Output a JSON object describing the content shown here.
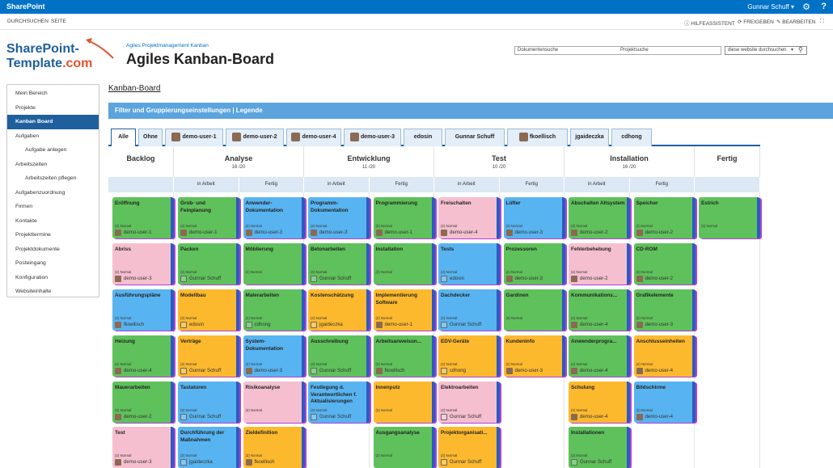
{
  "suitebar": {
    "brand": "SharePoint",
    "user": "Gunnar Schuff ▾",
    "gear": "⚙",
    "help": "?"
  },
  "ribbon": {
    "tabs": [
      "DURCHSUCHEN",
      "SEITE"
    ],
    "actions": [
      "ⓘ HILFEASSISTENT",
      "⟳ FREIGEBEN",
      "✎ BEARBEITEN",
      "⛶"
    ]
  },
  "logo": {
    "line1": "SharePoint-",
    "line2a": "Template",
    "line2b": ".com"
  },
  "site": {
    "subtitle": "Agiles Projektmanagement Kanban",
    "title": "Agiles Kanban-Board"
  },
  "search": {
    "scope1": "Dokumentensuche",
    "scope2": "Projektsuche",
    "placeholder": "diese website durchsuchen",
    "dropdown": "▾",
    "icon": "⚲"
  },
  "nav": [
    {
      "label": "Mein Bereich",
      "sub": false,
      "active": false
    },
    {
      "label": "Projekte",
      "sub": false,
      "active": false
    },
    {
      "label": "Kanban Board",
      "sub": false,
      "active": true
    },
    {
      "label": "Aufgaben",
      "sub": false,
      "active": false
    },
    {
      "label": "Aufgabe anlegen",
      "sub": true,
      "active": false
    },
    {
      "label": "Arbeitszeiten",
      "sub": false,
      "active": false
    },
    {
      "label": "Arbeitszeiten pflegen",
      "sub": true,
      "active": false
    },
    {
      "label": "Aufgabenzuordnung",
      "sub": false,
      "active": false
    },
    {
      "label": "Firmen",
      "sub": false,
      "active": false
    },
    {
      "label": "Kontakte",
      "sub": false,
      "active": false
    },
    {
      "label": "Projekttermine",
      "sub": false,
      "active": false
    },
    {
      "label": "Projektdokumente",
      "sub": false,
      "active": false
    },
    {
      "label": "Posteingang",
      "sub": false,
      "active": false
    },
    {
      "label": "Konfiguration",
      "sub": false,
      "active": false
    },
    {
      "label": "Websiteinhalte",
      "sub": false,
      "active": false
    }
  ],
  "breadcrumb": "Kanban-Board",
  "filterbar": "Filter und Gruppierungseinstellungen | Legende",
  "tabs": [
    {
      "label": "Alle",
      "avatar": false,
      "active": true
    },
    {
      "label": "Ohne",
      "avatar": false,
      "active": false
    },
    {
      "label": "demo-user-1",
      "avatar": true,
      "active": false
    },
    {
      "label": "demo-user-2",
      "avatar": true,
      "active": false
    },
    {
      "label": "demo-user-4",
      "avatar": true,
      "active": false
    },
    {
      "label": "demo-user-3",
      "avatar": true,
      "active": false
    },
    {
      "label": "edosin",
      "avatar": false,
      "active": false
    },
    {
      "label": "Gunnar Schuff",
      "avatar": false,
      "active": false
    },
    {
      "label": "fkoellisch",
      "avatar": true,
      "active": false
    },
    {
      "label": "jgaideczka",
      "avatar": false,
      "active": false
    },
    {
      "label": "cdhong",
      "avatar": false,
      "active": false
    }
  ],
  "columns": [
    {
      "name": "Backlog",
      "limit": "",
      "subs": []
    },
    {
      "name": "Analyse",
      "limit": "16 /20",
      "subs": [
        "in Arbeit",
        "Fertig"
      ]
    },
    {
      "name": "Entwicklung",
      "limit": "11 /20",
      "subs": [
        "in Arbeit",
        "Fertig"
      ]
    },
    {
      "name": "Test",
      "limit": "10 /20",
      "subs": [
        "in Arbeit",
        "Fertig"
      ]
    },
    {
      "name": "Installation",
      "limit": "16 /20",
      "subs": [
        "in Arbeit",
        "Fertig"
      ]
    },
    {
      "name": "Fertig",
      "limit": "",
      "subs": []
    }
  ],
  "priority_label": "(2) Normal",
  "lanes": [
    [
      {
        "title": "Eröffnung",
        "color": "green",
        "user": "demo-user-1",
        "photo": true
      },
      {
        "title": "Abriss",
        "color": "pink",
        "user": "demo-user-3",
        "photo": true
      },
      {
        "title": "Ausführungspläne",
        "color": "blue",
        "user": "fkoellisch",
        "photo": true
      },
      {
        "title": "Heizung",
        "color": "green",
        "user": "demo-user-4",
        "photo": true
      },
      {
        "title": "Mauerarbeiten",
        "color": "green",
        "user": "demo-user-2",
        "photo": true
      },
      {
        "title": "Test",
        "color": "pink",
        "user": "demo-user-3",
        "photo": true
      }
    ],
    [
      {
        "title": "Grob- und Feinplanung",
        "color": "green",
        "user": "demo-user-1",
        "photo": true
      },
      {
        "title": "Packen",
        "color": "green",
        "user": "Gunnar Schuff",
        "photo": false
      },
      {
        "title": "Modellbau",
        "color": "orange",
        "user": "edosin",
        "photo": false
      },
      {
        "title": "Verträge",
        "color": "orange",
        "user": "Gunnar Schuff",
        "photo": false
      },
      {
        "title": "Tastaturen",
        "color": "blue",
        "user": "Gunnar Schuff",
        "photo": false
      },
      {
        "title": "Durchführung der Maßnahmen",
        "color": "blue",
        "user": "jgaideczka",
        "photo": false
      }
    ],
    [
      {
        "title": "Anwender-Dokumentation",
        "color": "blue",
        "user": "demo-user-3",
        "photo": true
      },
      {
        "title": "Möblierung",
        "color": "green",
        "user": "",
        "photo": false
      },
      {
        "title": "Malerarbeiten",
        "color": "green",
        "user": "cdhong",
        "photo": false
      },
      {
        "title": "System-Dokumentation",
        "color": "blue",
        "user": "demo-user-3",
        "photo": true
      },
      {
        "title": "Risikoanalyse",
        "color": "pink",
        "user": "",
        "photo": false
      },
      {
        "title": "Zieldefinition",
        "color": "orange",
        "user": "fkoellisch",
        "photo": true
      }
    ],
    [
      {
        "title": "Programm-Dokumentation",
        "color": "blue",
        "user": "demo-user-3",
        "photo": true
      },
      {
        "title": "Betonarbeiten",
        "color": "green",
        "user": "Gunnar Schuff",
        "photo": false
      },
      {
        "title": "Kostenschätzung",
        "color": "orange",
        "user": "jgaideczka",
        "photo": false
      },
      {
        "title": "Ausschreibung",
        "color": "green",
        "user": "Gunnar Schuff",
        "photo": false
      },
      {
        "title": "Festlegung d. Verantwortlichen f. Aktualisierungen",
        "color": "blue",
        "user": "Gunnar Schuff",
        "photo": false
      }
    ],
    [
      {
        "title": "Programmierung",
        "color": "green",
        "user": "demo-user-1",
        "photo": true
      },
      {
        "title": "Installation",
        "color": "green",
        "user": "",
        "photo": false
      },
      {
        "title": "Implementierung Software",
        "color": "orange",
        "user": "demo-user-1",
        "photo": true
      },
      {
        "title": "Arbeitsanweisun...",
        "color": "green",
        "user": "fkoellisch",
        "photo": true
      },
      {
        "title": "Innenputz",
        "color": "orange",
        "user": "",
        "photo": false
      },
      {
        "title": "Ausgangsanalyse",
        "color": "green",
        "user": "",
        "photo": false
      }
    ],
    [
      {
        "title": "Freischalten",
        "color": "pink",
        "user": "demo-user-4",
        "photo": true
      },
      {
        "title": "Tests",
        "color": "blue",
        "user": "edosin",
        "photo": false
      },
      {
        "title": "Dachdecker",
        "color": "blue",
        "user": "Gunnar Schuff",
        "photo": false
      },
      {
        "title": "EDV-Geräte",
        "color": "orange",
        "user": "cdhong",
        "photo": false
      },
      {
        "title": "Elektroarbeiten",
        "color": "pink",
        "user": "Gunnar Schuff",
        "photo": false
      },
      {
        "title": "Projektorganisati...",
        "color": "orange",
        "user": "Gunnar Schuff",
        "photo": false
      }
    ],
    [
      {
        "title": "Lüfter",
        "color": "blue",
        "user": "demo-user-3",
        "photo": true
      },
      {
        "title": "Prozessoren",
        "color": "green",
        "user": "demo-user-3",
        "photo": true
      },
      {
        "title": "Gardinen",
        "color": "green",
        "user": "",
        "photo": false
      },
      {
        "title": "Kundeninfo",
        "color": "orange",
        "user": "demo-user-3",
        "photo": true
      }
    ],
    [
      {
        "title": "Abschalten Altsystem",
        "color": "green",
        "user": "demo-user-2",
        "photo": true
      },
      {
        "title": "Fehlerbehebung",
        "color": "pink",
        "user": "demo-user-2",
        "photo": true
      },
      {
        "title": "Kommunikations...",
        "color": "green",
        "user": "demo-user-4",
        "photo": true
      },
      {
        "title": "Anwenderprogra...",
        "color": "green",
        "user": "demo-user-4",
        "photo": true
      },
      {
        "title": "Schulung",
        "color": "orange",
        "user": "demo-user-4",
        "photo": true
      },
      {
        "title": "Installationen",
        "color": "green",
        "user": "Gunnar Schuff",
        "photo": false
      }
    ],
    [
      {
        "title": "Speicher",
        "color": "green",
        "user": "demo-user-2",
        "photo": true
      },
      {
        "title": "CD-ROM",
        "color": "green",
        "user": "demo-user-2",
        "photo": true
      },
      {
        "title": "Grafikelemente",
        "color": "green",
        "user": "demo-user-3",
        "photo": true
      },
      {
        "title": "Anschlusseinheiten",
        "color": "orange",
        "user": "demo-user-4",
        "photo": true
      },
      {
        "title": "Bildschirme",
        "color": "blue",
        "user": "demo-user-4",
        "photo": true
      }
    ],
    [
      {
        "title": "Estrich",
        "color": "green",
        "user": "",
        "photo": false
      }
    ]
  ]
}
